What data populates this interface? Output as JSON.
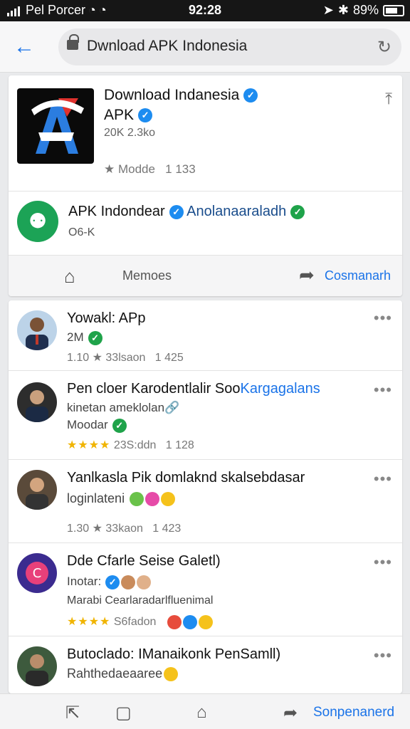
{
  "status_bar": {
    "carrier": "Pel Porcer",
    "time": "92:28",
    "battery": "89%"
  },
  "address_bar": {
    "url": "Dwnload APK Indonesia"
  },
  "app_card": {
    "title_line1": "Download Indanesia",
    "title_line2": "APK",
    "size": "20K 2.3ko",
    "meta": "Modde",
    "meta_count": "1 133",
    "publisher": {
      "name": "APK Indondear",
      "handle": "Anolanaaraladh",
      "sub": "O6-K"
    },
    "actions": {
      "memoes": "Memoes",
      "comment": "Cosmanarh"
    }
  },
  "feed": [
    {
      "title": "Yowakl: APp",
      "line1": "2M",
      "meta_a": "1.10",
      "meta_b": "33lsaon",
      "meta_c": "1 425"
    },
    {
      "title": "Pen cloer Karodentlalir Soo",
      "title_accent": "Kargagalans",
      "line1": "kinetan ameklolan",
      "line2": "Moodar",
      "stars": "★★★★",
      "meta_b": "23S:ddn",
      "meta_c": "1 128"
    },
    {
      "title": "Yanlkasla Pik domlaknd skalsebdasar",
      "line1": "loginlateni",
      "meta_a": "1.30",
      "meta_b": "33kaon",
      "meta_c": "1 423"
    },
    {
      "title": "Dde Cfarle Seise Galetl)",
      "line1": "Inotar:",
      "line2": "Marabi Cearlaradarlfluenimal",
      "stars": "★★★★",
      "meta_b": "S6fadon"
    },
    {
      "title": "Butoclado: IManaikonk PenSamll)",
      "line1": "Rahthedaeaaree"
    }
  ],
  "bottom_bar": {
    "label": "Sonpenanerd"
  },
  "colors": {
    "accent": "#1a73e8",
    "verified": "#1d8cf0",
    "green": "#1fa34a",
    "star": "#f0b400"
  }
}
